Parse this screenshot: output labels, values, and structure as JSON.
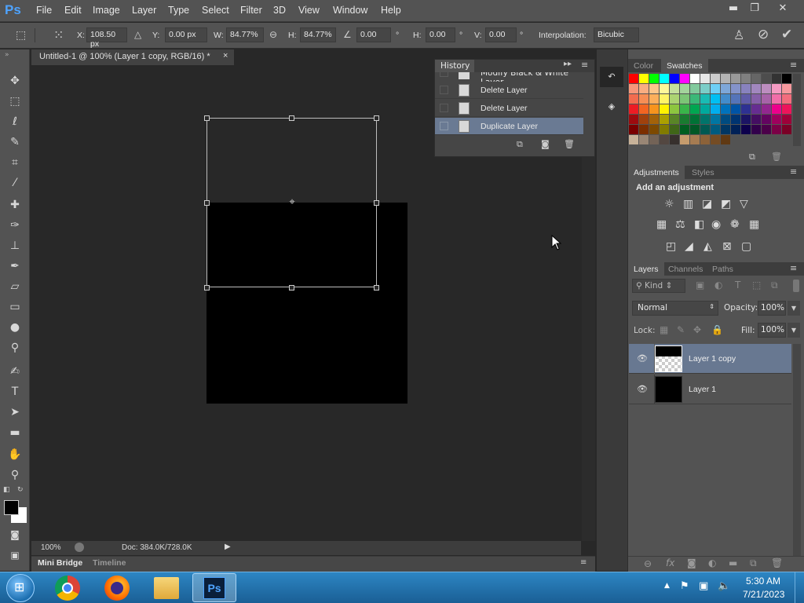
{
  "app": {
    "logo": "Ps"
  },
  "menu": [
    "File",
    "Edit",
    "Image",
    "Layer",
    "Type",
    "Select",
    "Filter",
    "3D",
    "View",
    "Window",
    "Help"
  ],
  "window_controls": {
    "minimize": "▬",
    "restore": "❐",
    "close": "✕"
  },
  "options": {
    "x_label": "X:",
    "x_value": "108.50 px",
    "y_label": "Y:",
    "y_value": "0.00 px",
    "w_label": "W:",
    "w_value": "84.77%",
    "h_label": "H:",
    "h_value": "84.77%",
    "rotate_value": "0.00",
    "rotate_unit": "°",
    "hskew_label": "H:",
    "hskew_value": "0.00",
    "hskew_unit": "°",
    "vskew_label": "V:",
    "vskew_value": "0.00",
    "vskew_unit": "°",
    "interp_label": "Interpolation:",
    "interp_value": "Bicubic"
  },
  "document": {
    "tab_title": "Untitled-1 @ 100% (Layer 1 copy, RGB/16) *",
    "close": "×"
  },
  "status": {
    "zoom": "100%",
    "doc": "Doc: 384.0K/728.0K"
  },
  "bottom_tabs": {
    "mini_bridge": "Mini Bridge",
    "timeline": "Timeline"
  },
  "history": {
    "title": "History",
    "items": [
      {
        "label": "Modify Black & White Layer"
      },
      {
        "label": "Delete Layer"
      },
      {
        "label": "Delete Layer"
      },
      {
        "label": "Duplicate Layer"
      }
    ]
  },
  "swatches_panel": {
    "tab_color": "Color",
    "tab_swatches": "Swatches"
  },
  "swatch_colors": [
    "#ff0000",
    "#ffff00",
    "#00ff00",
    "#00ffff",
    "#0000ff",
    "#ff00ff",
    "#ffffff",
    "#e6e6e6",
    "#cccccc",
    "#b3b3b3",
    "#999999",
    "#808080",
    "#666666",
    "#4d4d4d",
    "#333333",
    "#000000",
    "#f7977a",
    "#f9ad81",
    "#fdc68a",
    "#fff79a",
    "#c4df9b",
    "#a3d39c",
    "#82ca9d",
    "#7bcdc8",
    "#6ecff6",
    "#7ea7d8",
    "#8493ca",
    "#8882be",
    "#a187be",
    "#bc8dbf",
    "#f49ac2",
    "#f6989d",
    "#f26c4f",
    "#f68e55",
    "#fbaf5c",
    "#fff467",
    "#acd372",
    "#7cc576",
    "#3bb878",
    "#1abbb4",
    "#00bff3",
    "#438ccb",
    "#5574b9",
    "#605ca8",
    "#855fa8",
    "#a763a8",
    "#f06ea9",
    "#f26d7d",
    "#ed1c24",
    "#f26522",
    "#f7941d",
    "#fff200",
    "#8dc63f",
    "#39b54a",
    "#00a651",
    "#00a99d",
    "#00aeef",
    "#0072bc",
    "#0054a6",
    "#2e3192",
    "#662d91",
    "#92278f",
    "#ec008c",
    "#ed145b",
    "#9e0b0f",
    "#a0410d",
    "#a36209",
    "#aba000",
    "#598527",
    "#197b30",
    "#007236",
    "#00746b",
    "#0076a3",
    "#004b80",
    "#003471",
    "#1b1464",
    "#440e62",
    "#630460",
    "#9e005d",
    "#9e0039",
    "#790000",
    "#7b2e00",
    "#7d4900",
    "#827b00",
    "#406618",
    "#005e20",
    "#005826",
    "#005952",
    "#005b7f",
    "#003663",
    "#002157",
    "#0d004c",
    "#32004b",
    "#4b0049",
    "#7b0046",
    "#7a0026",
    "#c7b299",
    "#998675",
    "#736357",
    "#534741",
    "#37302d",
    "#c69c6d",
    "#a67c52",
    "#8c6239",
    "#754c24",
    "#603913"
  ],
  "adjustments": {
    "tab_adjustments": "Adjustments",
    "tab_styles": "Styles",
    "heading": "Add an adjustment"
  },
  "layers_panel": {
    "tab_layers": "Layers",
    "tab_channels": "Channels",
    "tab_paths": "Paths",
    "kind": "Kind",
    "blend_mode": "Normal",
    "opacity_label": "Opacity:",
    "opacity_value": "100%",
    "lock_label": "Lock:",
    "fill_label": "Fill:",
    "fill_value": "100%",
    "layers": [
      {
        "name": "Layer 1 copy"
      },
      {
        "name": "Layer 1"
      }
    ]
  },
  "taskbar": {
    "time": "5:30 AM",
    "date": "7/21/2023",
    "ps": "Ps"
  }
}
